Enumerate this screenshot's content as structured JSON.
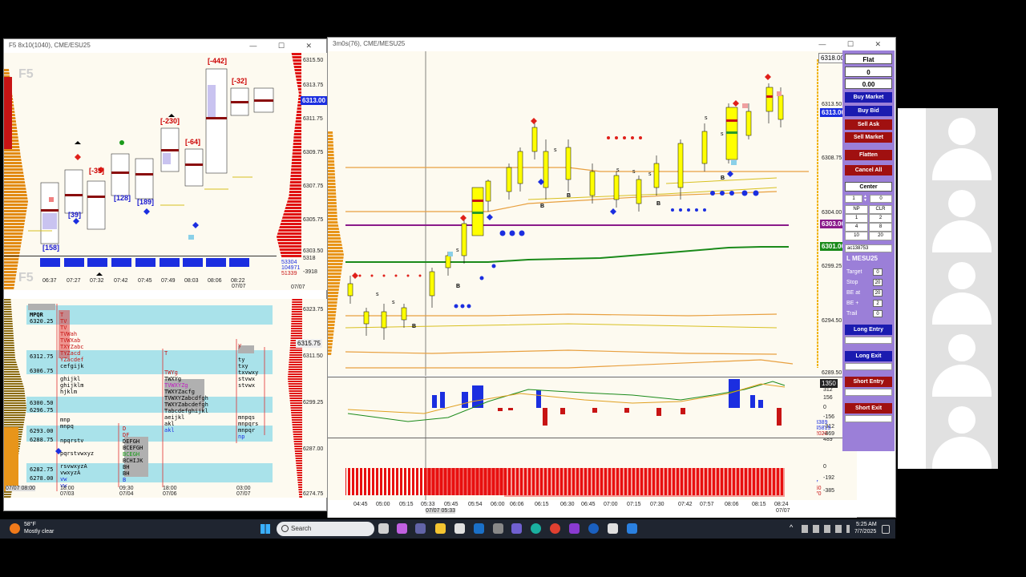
{
  "left_window": {
    "title": "F5 8x10(1040), CME/ESU25",
    "watermark_top": "F5",
    "watermark_bottom": "F5",
    "price_ticks": [
      "6315.50",
      "6313.75",
      "6311.75",
      "6309.75",
      "6307.75",
      "6305.75",
      "6303.50"
    ],
    "current_price": "6313.00",
    "time_labels": [
      "06:37",
      "07:27",
      "07:32",
      "07:42",
      "07:45",
      "07:49",
      "08:03",
      "08:06",
      "08:22"
    ],
    "date_label": "07/07",
    "date_label_axis": "07/07",
    "deltas": [
      "[-442]",
      "[-32]",
      "[-230]",
      "[-35]",
      "[-64]"
    ],
    "volumes": [
      "[158]",
      "[39]",
      "[128]",
      "[189]"
    ],
    "bottom_stats": [
      "53304",
      "104971",
      "51339"
    ],
    "axis_small": [
      "5318",
      "-3918"
    ],
    "tpo_price_ticks": [
      "6323.75",
      "6311.50",
      "6299.25",
      "6287.00",
      "6274.75"
    ],
    "tpo_date_labels": [
      "07/07 08:00",
      "18:00",
      "09:30",
      "18:00",
      "03:00"
    ],
    "tpo_date_sub": [
      "07/03",
      "07/04",
      "07/06",
      "07/07"
    ],
    "tpo_tags": [
      "6320.25",
      "6312.75",
      "6306.75",
      "6300.50",
      "6296.75",
      "6293.00",
      "6288.75",
      "6282.75",
      "6278.00"
    ],
    "tpo_header": "MPQR",
    "tpo_current": "6315.75",
    "tpo_rows": [
      "cefgijk",
      "ghijkl",
      "ghijklm",
      "hjklm",
      "mnp",
      "mnpq",
      "npqrstv",
      "pqrstvwxyz",
      "rsvwxyzA",
      "vwxyzA",
      "vw",
      "vw"
    ]
  },
  "main_window": {
    "title": "3m0s(76), CME/MESU25",
    "price_ticks": [
      "6313.50",
      "6308.75",
      "6304.00",
      "6299.25",
      "6294.50",
      "6289.50"
    ],
    "top_price": "6318.00",
    "current_price": "6313.00",
    "price_box_magenta": "6303.00",
    "price_box_green": "6301.00",
    "time_labels": [
      "04:45",
      "05:00",
      "05:15",
      "05:33",
      "05:45",
      "05:54",
      "06:00",
      "06:06",
      "06:15",
      "06:30",
      "06:45",
      "07:00",
      "07:15",
      "07:30",
      "07:42",
      "07:57",
      "08:06",
      "08:15",
      "08:24"
    ],
    "cursor_time": "07/07 05:33",
    "last_date": "07/07",
    "osc_ticks": [
      "312",
      "156",
      "0",
      "-156",
      "-312",
      "-469"
    ],
    "osc_last": "1350",
    "osc_stats": [
      "73389",
      "145815",
      "72020"
    ],
    "cvd_ticks": [
      "0",
      "-192",
      "-385"
    ],
    "cvd_stats": [
      "897",
      "2760",
      "1470"
    ],
    "cvd_top": "489"
  },
  "order_panel": {
    "position": "Flat",
    "qty": "0",
    "pnl": "0.00",
    "buttons": [
      "Buy Market",
      "Buy Bid",
      "Sell Ask",
      "Sell Market",
      "Flatten",
      "Cancel All"
    ],
    "center": "Center",
    "qty_input": "1",
    "qty_right": "0",
    "grid": [
      "NP",
      "CLR",
      "1",
      "2",
      "4",
      "8",
      "10",
      "20"
    ],
    "account": "ac138753",
    "instrument": "L MESU25",
    "fields": [
      {
        "label": "Target",
        "value": "0"
      },
      {
        "label": "Stop",
        "value": "20"
      },
      {
        "label": "BE at",
        "value": "20"
      },
      {
        "label": "BE +",
        "value": "2"
      },
      {
        "label": "Trail",
        "value": "0"
      }
    ],
    "long_entry": "Long Entry",
    "long_exit": "Long Exit",
    "short_entry": "Short Entry",
    "short_exit": "Short Exit"
  },
  "taskbar": {
    "weather_temp": "58°F",
    "weather_desc": "Mostly clear",
    "search_placeholder": "Search",
    "time": "5:25 AM",
    "date": "7/7/2025"
  },
  "colors": {
    "buy": "#1b2ee0",
    "sell": "#c81414",
    "panel": "#9b7fd8",
    "candle_body": "#ffff00"
  }
}
